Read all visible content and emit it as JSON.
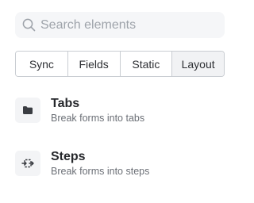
{
  "search": {
    "placeholder": "Search elements",
    "value": "",
    "icon": "search-icon"
  },
  "tabs": [
    {
      "label": "Sync",
      "active": false
    },
    {
      "label": "Fields",
      "active": false
    },
    {
      "label": "Static",
      "active": false
    },
    {
      "label": "Layout",
      "active": true
    }
  ],
  "items": [
    {
      "title": "Tabs",
      "description": "Break forms into tabs",
      "icon": "folder-icon"
    },
    {
      "title": "Steps",
      "description": "Break forms into steps",
      "icon": "steps-icon"
    }
  ],
  "colors": {
    "search_bg": "#f5f6f8",
    "border": "#c9cdd2",
    "active_tab_bg": "#f1f2f4",
    "icon_tile_bg": "#f3f4f6"
  }
}
